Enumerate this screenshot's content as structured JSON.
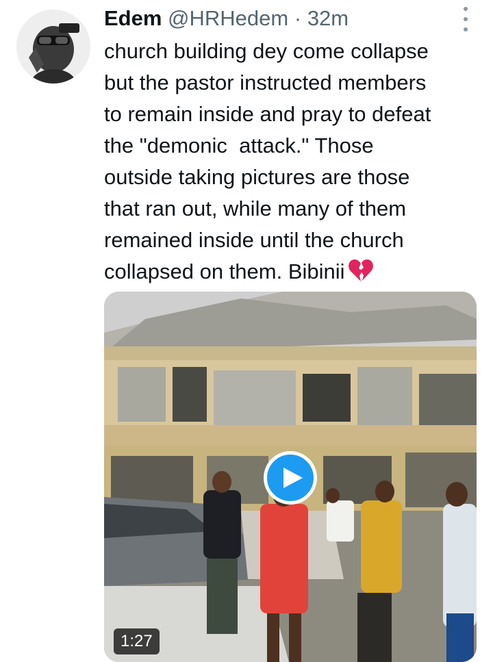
{
  "tweet": {
    "author_name": "Edem",
    "author_handle": "@HRHedem",
    "separator": "·",
    "timestamp": "32m",
    "text_lines": [
      "church building dey come collapse",
      "but the pastor instructed members",
      "to remain inside and pray to defeat",
      "the \"demonic  attack.\" Those",
      "outside taking pictures are those",
      "that ran out, while many of them",
      "remained inside until the church",
      "collapsed on them. Bibinii"
    ],
    "emoji": "broken-heart-icon"
  },
  "video": {
    "duration": "1:27",
    "play_icon": "play-icon"
  },
  "colors": {
    "accent": "#1d9bf0",
    "secondary_text": "#536471",
    "primary_text": "#0f1419",
    "heart": "#e0245e"
  }
}
